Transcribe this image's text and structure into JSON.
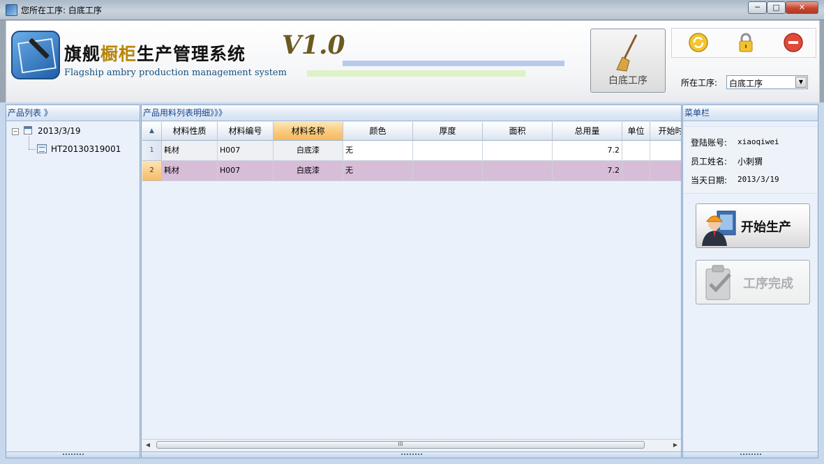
{
  "window": {
    "title": "您所在工序: 白底工序",
    "minimize": "─",
    "maximize": "□",
    "close": "✕"
  },
  "header": {
    "title_prefix": "旗舰",
    "title_highlight": "橱柜",
    "title_suffix": "生产管理系统",
    "version": "V1.0",
    "subtitle": "Flagship ambry production management system",
    "step_button_label": "白底工序",
    "step_label": "所在工序:",
    "step_value": "白底工序",
    "icons": [
      "refresh-icon",
      "lock-icon",
      "exit-icon"
    ]
  },
  "left_panel": {
    "title": "产品列表 》",
    "tree": {
      "date": "2013/3/19",
      "order": "HT20130319001",
      "collapse_glyph": "−"
    }
  },
  "mid_panel": {
    "title": "产品用料列表明细》》》",
    "columns": [
      "材料性质",
      "材料编号",
      "材料名称",
      "颜色",
      "厚度",
      "面积",
      "总用量",
      "单位",
      "开始时"
    ],
    "rows": [
      {
        "index": "1",
        "cells": [
          "耗材",
          "H007",
          "白底漆",
          "无",
          "",
          "",
          "7.2",
          "",
          ""
        ]
      },
      {
        "index": "2",
        "cells": [
          "耗材",
          "H007",
          "白底漆",
          "无",
          "",
          "",
          "7.2",
          "",
          ""
        ]
      }
    ],
    "scroll_grip": "III"
  },
  "right_panel": {
    "title": "菜单栏",
    "account_label": "登陆账号:",
    "account": "xiaoqiwei",
    "name_label": "员工姓名:",
    "name": "小刺猬",
    "date_label": "当天日期:",
    "date": "2013/3/19",
    "start_button": "开始生产",
    "done_button": "工序完成"
  },
  "colors": {
    "accent": "#15428b",
    "selected_row": "#d8bdd8",
    "selected_header": "#f9c778"
  }
}
